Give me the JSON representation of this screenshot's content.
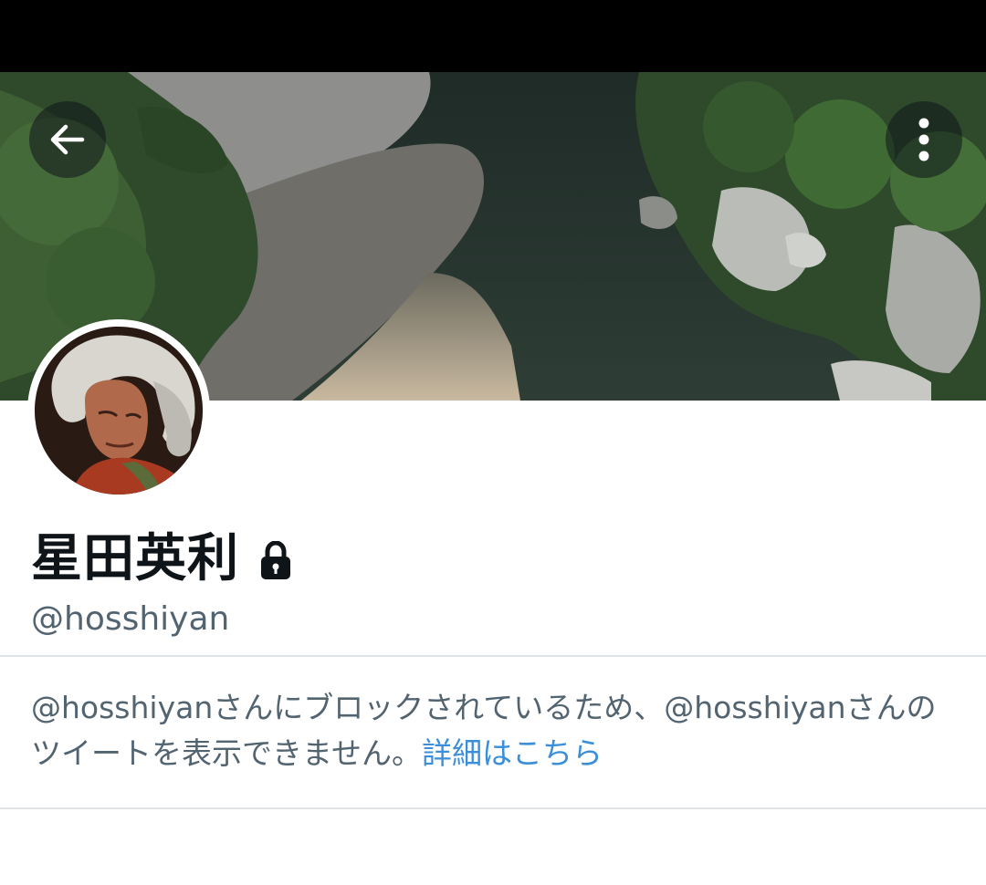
{
  "profile": {
    "display_name": "星田英利",
    "handle": "@hosshiyan",
    "protected": true
  },
  "header": {
    "back_icon": "arrow-left-icon",
    "more_icon": "more-vertical-icon"
  },
  "blocked_notice": {
    "message": "@hosshiyanさんにブロックされているため、@hosshiyanさんのツイートを表示できません。",
    "link_label": "詳細はこちら"
  },
  "colors": {
    "link": "#1d9bf0",
    "secondary_text": "#536471",
    "divider": "#dfe3e6"
  }
}
